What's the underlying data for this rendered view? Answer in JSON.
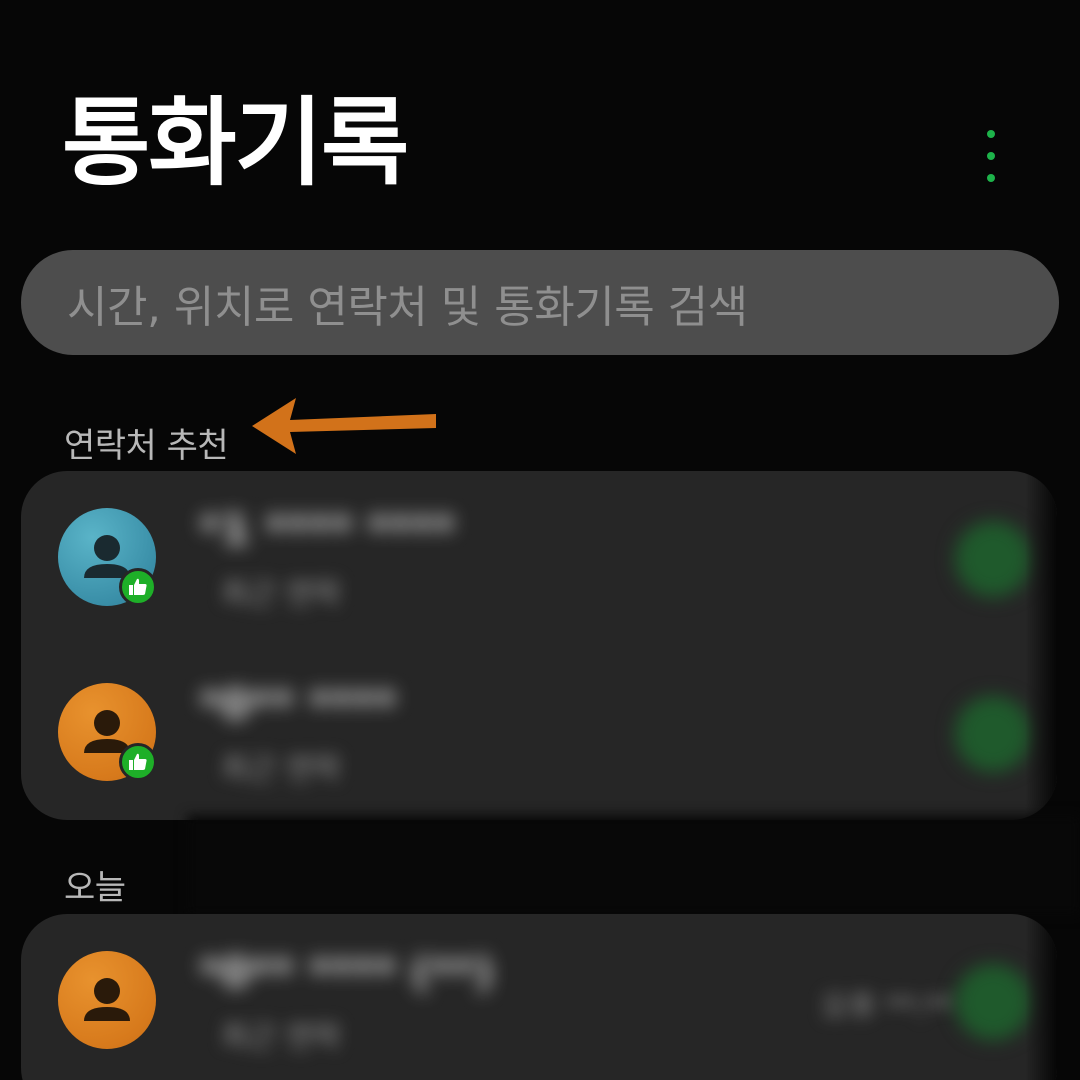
{
  "header": {
    "title": "통화기록"
  },
  "search": {
    "placeholder": "시간, 위치로 연락처 및 통화기록 검색"
  },
  "sections": {
    "recommended": {
      "label": "연락처 추천",
      "items": [
        {
          "avatar_color": "#3e98b2",
          "badge": "thumbs-up-icon",
          "name": "*1 **** ****",
          "sub": "최근 연락"
        },
        {
          "avatar_color": "#d77a1c",
          "badge": "thumbs-up-icon",
          "name": "*0** ****",
          "sub": "최근 연락"
        }
      ]
    },
    "today": {
      "label": "오늘",
      "items": [
        {
          "avatar_color": "#d77a1c",
          "name": "*0** **** (**)",
          "sub": "최근 연락",
          "time": "오후 **:**"
        }
      ]
    }
  },
  "colors": {
    "accent": "#1db34a",
    "annotation_arrow": "#d2721a",
    "card": "#262626",
    "background": "#060606"
  }
}
